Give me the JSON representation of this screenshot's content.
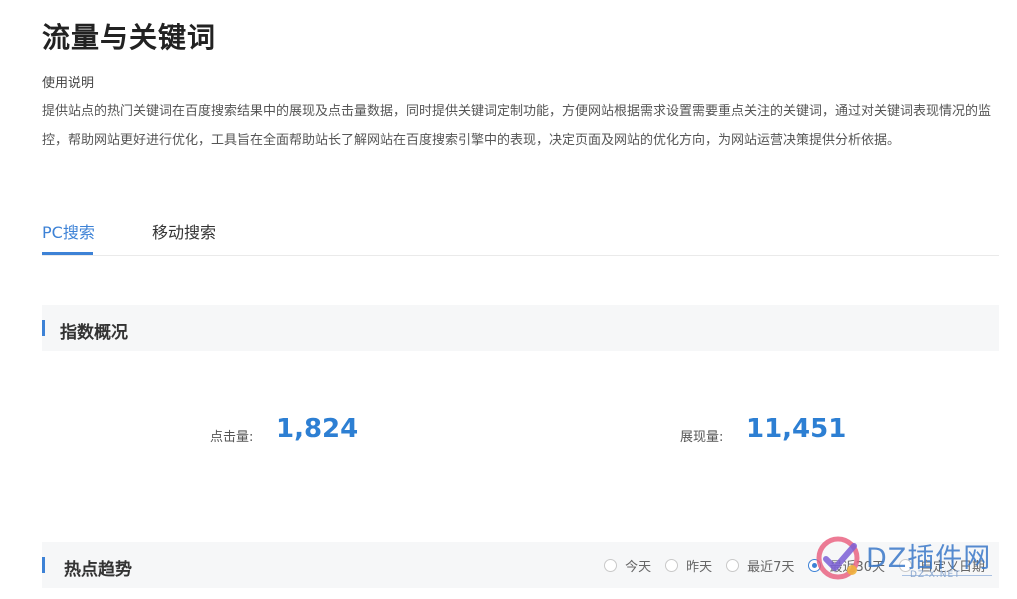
{
  "header": {
    "title": "流量与关键词",
    "usage_heading": "使用说明",
    "usage_text": "提供站点的热门关键词在百度搜索结果中的展现及点击量数据，同时提供关键词定制功能，方便网站根据需求设置需要重点关注的关键词，通过对关键词表现情况的监控，帮助网站更好进行优化，工具旨在全面帮助站长了解网站在百度搜索引擎中的表现，决定页面及网站的优化方向，为网站运营决策提供分析依据。"
  },
  "tabs": [
    {
      "label": "PC搜索",
      "active": true
    },
    {
      "label": "移动搜索",
      "active": false
    }
  ],
  "index_overview": {
    "title": "指数概况",
    "clicks_label": "点击量:",
    "clicks_value": "1,824",
    "impressions_label": "展现量:",
    "impressions_value": "11,451"
  },
  "hot_trend": {
    "title": "热点趋势",
    "date_options": [
      {
        "label": "今天",
        "selected": false
      },
      {
        "label": "昨天",
        "selected": false
      },
      {
        "label": "最近7天",
        "selected": false
      },
      {
        "label": "最近30天",
        "selected": true
      },
      {
        "label": "自定义日期",
        "selected": false
      }
    ]
  },
  "watermark": {
    "text": "DZ插件网",
    "sub": "DZ-X.NET"
  },
  "colors": {
    "accent": "#3d82d6",
    "metric": "#2d7fd3",
    "section_bg": "#f6f7f8"
  }
}
